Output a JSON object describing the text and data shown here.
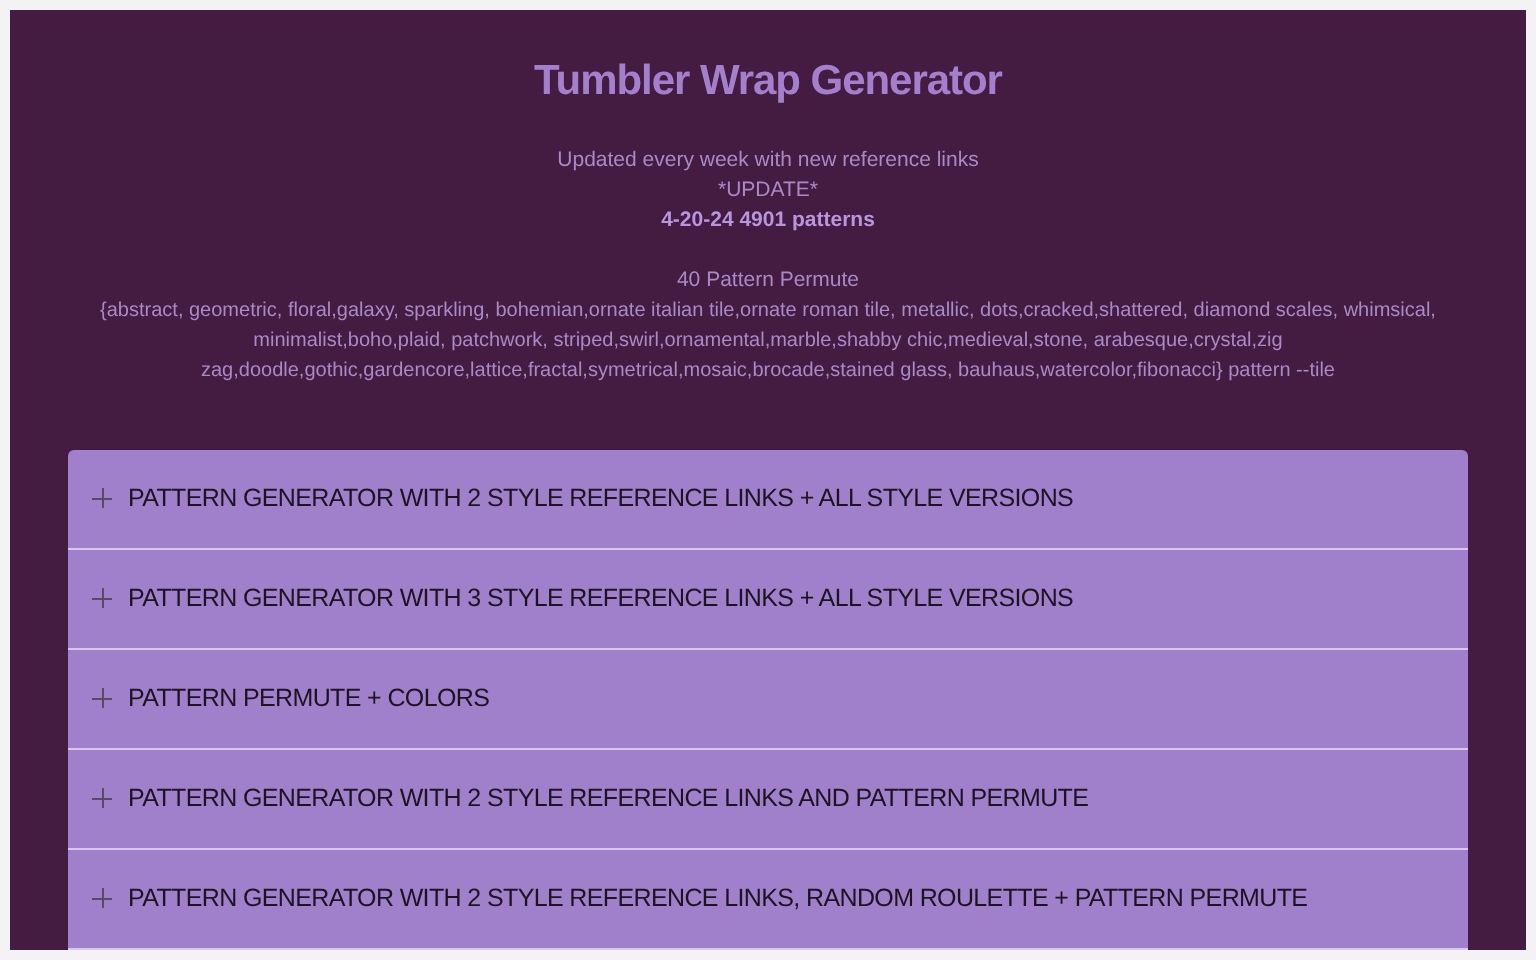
{
  "title": "Tumbler Wrap Generator",
  "intro": [
    "Updated every week with new reference links",
    "*UPDATE*"
  ],
  "update_note": "4-20-24 4901 patterns",
  "permute_heading": "40 Pattern Permute",
  "permute_list": "{abstract, geometric, floral,galaxy, sparkling, bohemian,ornate italian tile,ornate roman tile, metallic, dots,cracked,shattered, diamond scales, whimsical, minimalist,boho,plaid, patchwork, striped,swirl,ornamental,marble,shabby chic,medieval,stone, arabesque,crystal,zig zag,doodle,gothic,gardencore,lattice,fractal,symetrical,mosaic,brocade,stained glass, bauhaus,watercolor,fibonacci} pattern --tile",
  "accordion": [
    {
      "label": "PATTERN GENERATOR WITH 2 STYLE REFERENCE LINKS + ALL STYLE VERSIONS",
      "expanded": false
    },
    {
      "label": "PATTERN GENERATOR WITH 3 STYLE REFERENCE LINKS + ALL STYLE VERSIONS",
      "expanded": false
    },
    {
      "label": "PATTERN PERMUTE + COLORS",
      "expanded": false
    },
    {
      "label": "PATTERN GENERATOR WITH 2 STYLE REFERENCE LINKS AND PATTERN PERMUTE",
      "expanded": false
    },
    {
      "label": "PATTERN GENERATOR WITH 2 STYLE REFERENCE LINKS, RANDOM ROULETTE + PATTERN PERMUTE",
      "expanded": false
    }
  ]
}
